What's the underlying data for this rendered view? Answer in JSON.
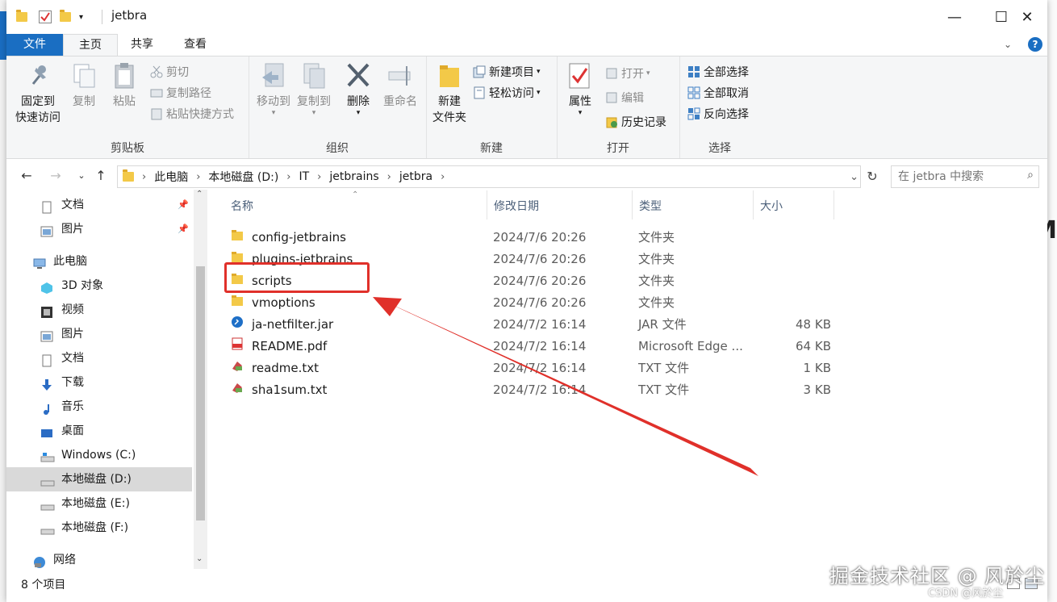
{
  "window": {
    "title": "jetbra",
    "controls": {
      "minimize": "—",
      "maximize": "☐",
      "close": "✕"
    }
  },
  "tabs": {
    "file": "文件",
    "home": "主页",
    "share": "共享",
    "view": "查看"
  },
  "ribbon": {
    "clipboard": {
      "title": "剪贴板",
      "pin_line1": "固定到",
      "pin_line2": "快速访问",
      "copy": "复制",
      "paste": "粘贴",
      "cut": "剪切",
      "copy_path": "复制路径",
      "paste_shortcut": "粘贴快捷方式"
    },
    "organize": {
      "title": "组织",
      "move_to": "移动到",
      "copy_to": "复制到",
      "delete": "删除",
      "rename": "重命名"
    },
    "new": {
      "title": "新建",
      "new_folder_line1": "新建",
      "new_folder_line2": "文件夹",
      "new_item": "新建项目",
      "easy_access": "轻松访问"
    },
    "open": {
      "title": "打开",
      "properties": "属性",
      "open": "打开",
      "edit": "编辑",
      "history": "历史记录"
    },
    "select": {
      "title": "选择",
      "select_all": "全部选择",
      "select_none": "全部取消",
      "invert": "反向选择"
    }
  },
  "address": {
    "crumbs": [
      "此电脑",
      "本地磁盘 (D:)",
      "IT",
      "jetbrains",
      "jetbra"
    ],
    "search_placeholder": "在 jetbra 中搜索"
  },
  "nav": {
    "items": [
      {
        "label": "文档"
      },
      {
        "label": "图片"
      },
      {
        "label": "此电脑"
      },
      {
        "label": "3D 对象"
      },
      {
        "label": "视频"
      },
      {
        "label": "图片"
      },
      {
        "label": "文档"
      },
      {
        "label": "下载"
      },
      {
        "label": "音乐"
      },
      {
        "label": "桌面"
      },
      {
        "label": "Windows (C:)"
      },
      {
        "label": "本地磁盘 (D:)"
      },
      {
        "label": "本地磁盘 (E:)"
      },
      {
        "label": "本地磁盘 (F:)"
      },
      {
        "label": "网络"
      }
    ]
  },
  "columns": {
    "name": "名称",
    "date": "修改日期",
    "type": "类型",
    "size": "大小"
  },
  "files": [
    {
      "name": "config-jetbrains",
      "date": "2024/7/6 20:26",
      "type": "文件夹",
      "size": ""
    },
    {
      "name": "plugins-jetbrains",
      "date": "2024/7/6 20:26",
      "type": "文件夹",
      "size": ""
    },
    {
      "name": "scripts",
      "date": "2024/7/6 20:26",
      "type": "文件夹",
      "size": ""
    },
    {
      "name": "vmoptions",
      "date": "2024/7/6 20:26",
      "type": "文件夹",
      "size": ""
    },
    {
      "name": "ja-netfilter.jar",
      "date": "2024/7/2 16:14",
      "type": "JAR 文件",
      "size": "48 KB"
    },
    {
      "name": "README.pdf",
      "date": "2024/7/2 16:14",
      "type": "Microsoft Edge ...",
      "size": "64 KB"
    },
    {
      "name": "readme.txt",
      "date": "2024/7/2 16:14",
      "type": "TXT 文件",
      "size": "1 KB"
    },
    {
      "name": "sha1sum.txt",
      "date": "2024/7/2 16:14",
      "type": "TXT 文件",
      "size": "3 KB"
    }
  ],
  "status": {
    "count": "8 个项目"
  },
  "watermark": {
    "main": "掘金技术社区 @ 风於尘",
    "sub": "CSDN @风於尘"
  },
  "colors": {
    "accent": "#1a6ec2",
    "highlight": "#e0302a",
    "folder": "#f3c948"
  }
}
